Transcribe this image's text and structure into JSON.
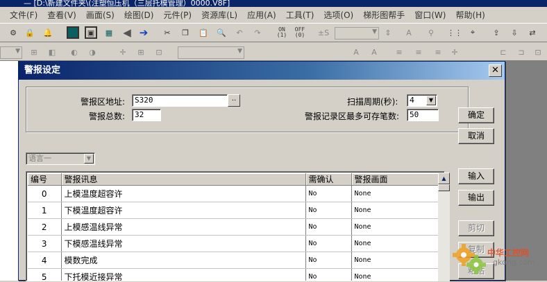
{
  "app": {
    "title": "— [D:\\新建文件夹\\(注塑恒压机（三层托模管理）0000.V8F]",
    "menu": [
      "文件(F)",
      "查看(V)",
      "画面(S)",
      "绘图(D)",
      "元件(P)",
      "资源库(L)",
      "应用(A)",
      "工具(T)",
      "选项(O)",
      "梯形图帮手",
      "窗口(W)",
      "帮助(H)"
    ],
    "toolbar": {
      "on_label": "ON",
      "on_sub": "(1)",
      "off_label": "OFF",
      "off_sub": "(0)",
      "pm_label": "±S"
    }
  },
  "dialog": {
    "title": "警报设定",
    "close_glyph": "✕",
    "fields": {
      "address_label": "警报区地址:",
      "address_value": "S320",
      "browse_label": "..",
      "total_label": "警报总数:",
      "total_value": "32",
      "scan_label": "扫描周期(秒):",
      "scan_value": "4",
      "max_records_label": "警报记录区最多可存笔数:",
      "max_records_value": "50"
    },
    "language_select": "语言一",
    "buttons": {
      "ok": "确定",
      "cancel": "取消",
      "import": "输入",
      "export": "输出",
      "cut": "剪切",
      "copy": "复制",
      "paste": "粘贴"
    },
    "table": {
      "headers": [
        "编号",
        "警报讯息",
        "需确认",
        "警报画面"
      ],
      "rows": [
        [
          "0",
          "上模温度超容许",
          "No",
          "None"
        ],
        [
          "1",
          "下模温度超容许",
          "No",
          "None"
        ],
        [
          "2",
          "上模感温线异常",
          "No",
          "None"
        ],
        [
          "3",
          "下模感温线异常",
          "No",
          "None"
        ],
        [
          "4",
          "模数完成",
          "No",
          "None"
        ],
        [
          "5",
          "下托模近接异常",
          "No",
          "None"
        ]
      ]
    }
  },
  "watermark": {
    "text": "中华工控网",
    "domain": "gkong.com"
  }
}
